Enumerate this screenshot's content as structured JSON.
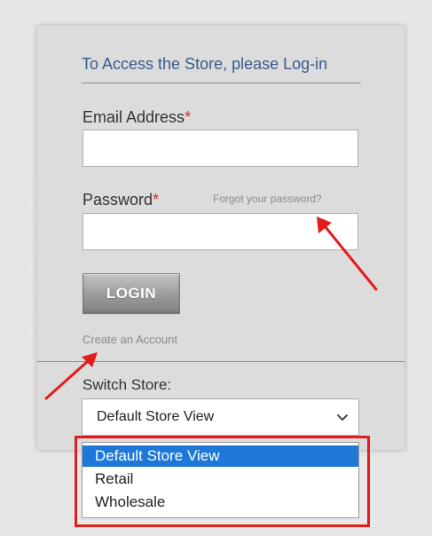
{
  "login_panel": {
    "title": "To Access the Store, please Log-in",
    "email": {
      "label": "Email Address",
      "required_mark": "*",
      "value": ""
    },
    "password": {
      "label": "Password",
      "required_mark": "*",
      "value": "",
      "forgot_link": "Forgot your password?"
    },
    "login_button": "LOGIN",
    "create_account_link": "Create an Account"
  },
  "store_switcher": {
    "label": "Switch Store:",
    "selected": "Default Store View",
    "options": [
      "Default Store View",
      "Retail",
      "Wholesale"
    ],
    "highlighted_option": "Default Store View"
  },
  "annotations": {
    "arrow_color": "#e31c1c",
    "highlight_box_color": "#e31c1c",
    "arrow_targets": [
      "forgot-password-link",
      "create-account-link"
    ]
  },
  "colors": {
    "title": "#3a5a8c",
    "required": "#d62b2b",
    "option_highlight": "#1e78d7"
  },
  "icons": {
    "select_chevron": "chevron-down-icon"
  }
}
